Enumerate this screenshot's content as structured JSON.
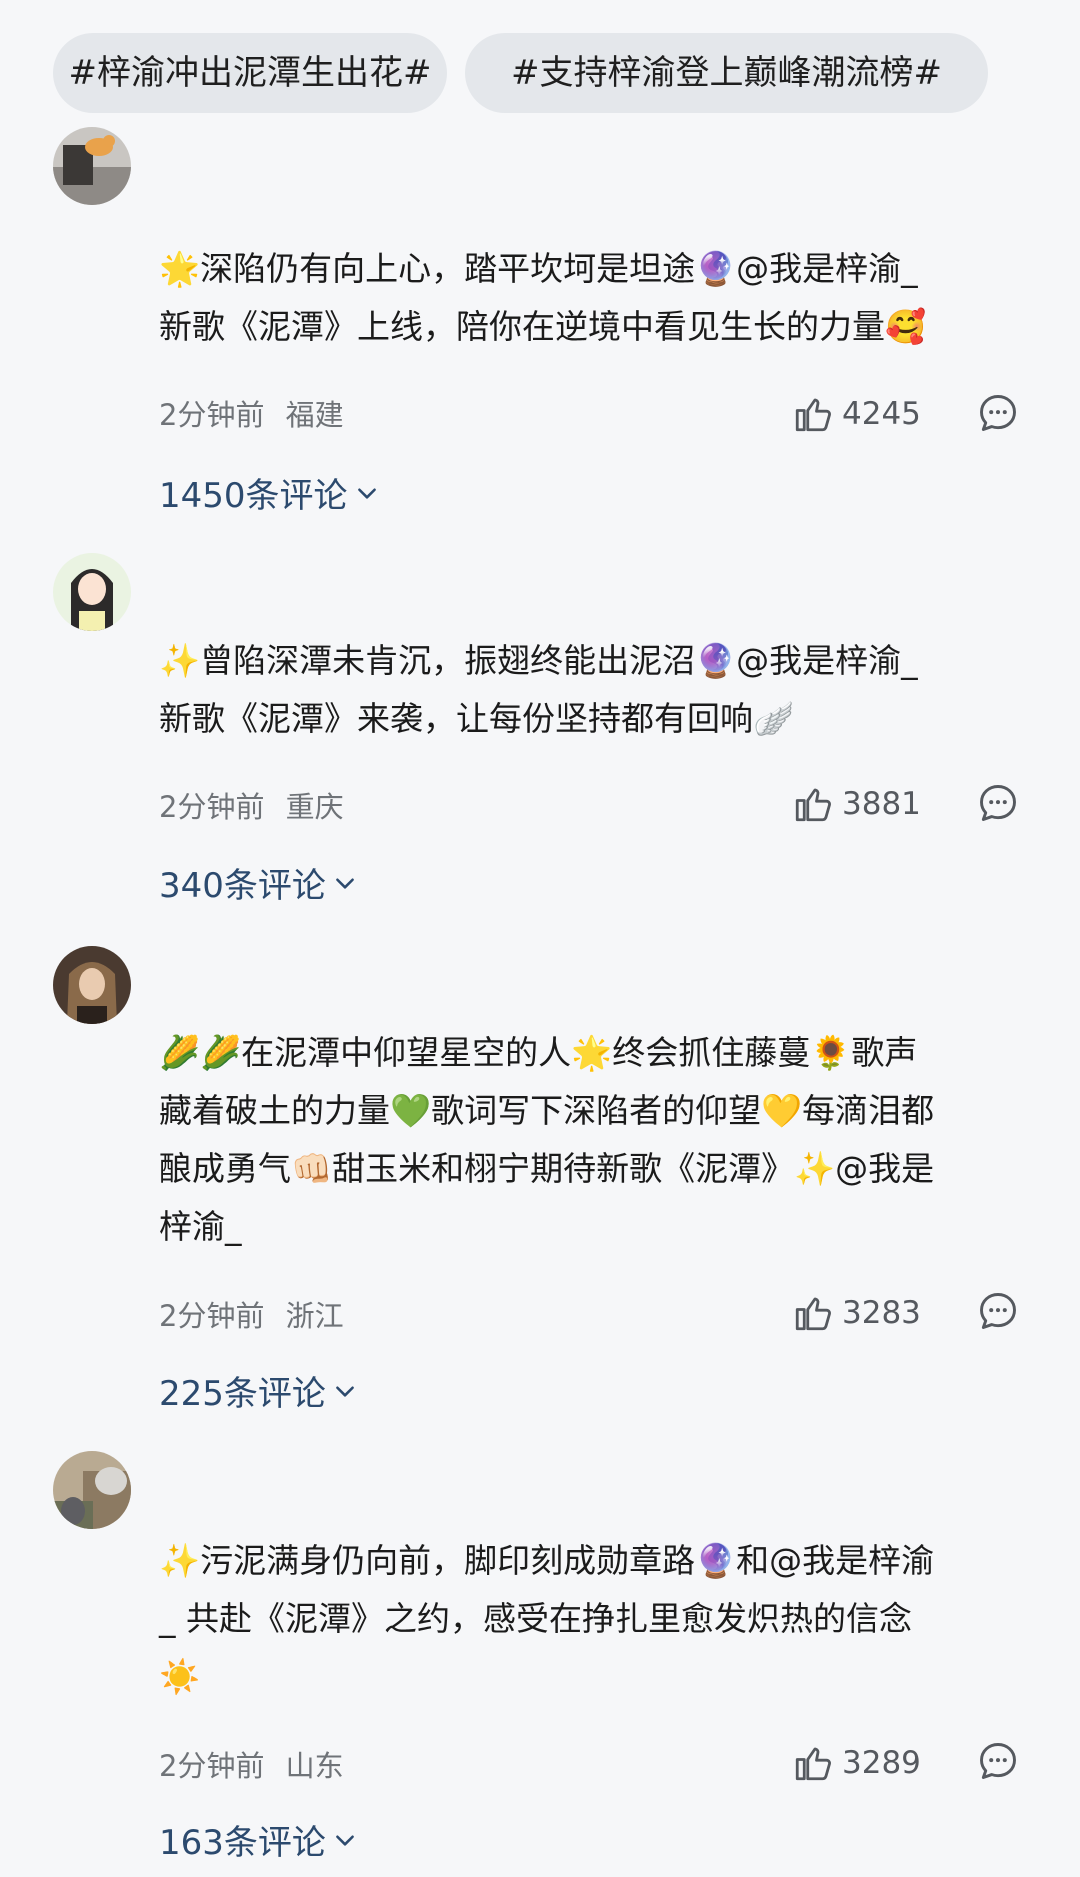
{
  "topics": [
    "#梓渝冲出泥潭生出花#",
    "#支持梓渝登上巅峰潮流榜#"
  ],
  "comments": [
    {
      "text": "🌟深陷仍有向上心，踏平坎坷是坦途🔮@我是梓渝_\n新歌《泥潭》上线，陪你在逆境中看见生长的力量🥰",
      "time": "2分钟前",
      "location": "福建",
      "likes": "4245",
      "replies": "1450条评论"
    },
    {
      "text": "✨曾陷深潭未肯沉，振翅终能出泥沼🔮@我是梓渝_\n新歌《泥潭》来袭，让每份坚持都有回响🪽",
      "time": "2分钟前",
      "location": "重庆",
      "likes": "3881",
      "replies": "340条评论"
    },
    {
      "text": "🌽🌽在泥潭中仰望星空的人🌟终会抓住藤蔓🌻歌声\n藏着破土的力量💚歌词写下深陷者的仰望💛每滴泪都\n酿成勇气👊🏻甜玉米和栩宁期待新歌《泥潭》✨@我是\n梓渝_",
      "time": "2分钟前",
      "location": "浙江",
      "likes": "3283",
      "replies": "225条评论"
    },
    {
      "text": "✨污泥满身仍向前，脚印刻成勋章路🔮和@我是梓渝\n_ 共赴《泥潭》之约，感受在挣扎里愈发炽热的信念\n☀️",
      "time": "2分钟前",
      "location": "山东",
      "likes": "3289",
      "replies": "163条评论"
    }
  ],
  "icons": {
    "like": "thumbs-up-icon",
    "reply": "comment-bubble-icon",
    "expand": "chevron-down-icon"
  },
  "colors": {
    "background": "#f6f7f9",
    "tag_bg": "#e4e7eb",
    "reply_link": "#2c4a6e",
    "meta_text": "#6f7378"
  }
}
